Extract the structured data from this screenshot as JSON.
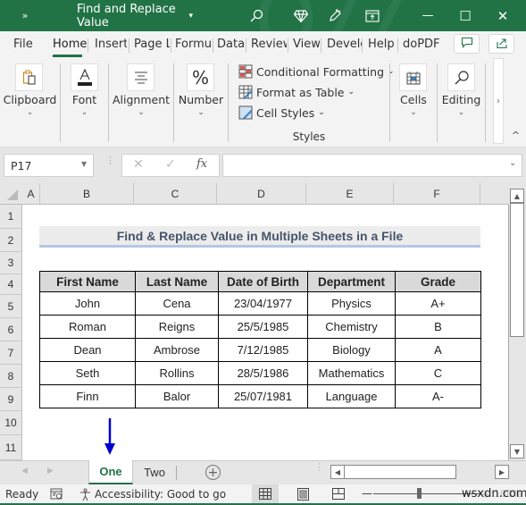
{
  "titlebar": {
    "overflow_label": "»",
    "doc_title": "Find and Replace Value",
    "title_caret": "⌄",
    "icons": [
      "search-icon",
      "diamond-icon",
      "pen-icon",
      "ribbon-display-icon"
    ],
    "minimize": "—",
    "maximize": "☐",
    "close": "✕"
  },
  "menu_tabs": {
    "items": [
      {
        "label": "File",
        "active": false
      },
      {
        "label": "Home",
        "active": true
      },
      {
        "label": "Insert",
        "active": false
      },
      {
        "label": "Page L",
        "active": false
      },
      {
        "label": "Formu",
        "active": false
      },
      {
        "label": "Data",
        "active": false
      },
      {
        "label": "Review",
        "active": false
      },
      {
        "label": "View",
        "active": false
      },
      {
        "label": "Develc",
        "active": false
      },
      {
        "label": "Help",
        "active": false
      },
      {
        "label": "doPDF",
        "active": false
      }
    ],
    "comments_icon": "comment-icon",
    "share_icon": "share-icon"
  },
  "ribbon": {
    "groups": [
      {
        "label": "Clipboard",
        "icon": "clipboard-icon",
        "caret": "⌄"
      },
      {
        "label": "Font",
        "icon": "font-color-icon",
        "caret": "⌄"
      },
      {
        "label": "Alignment",
        "icon": "align-icon",
        "caret": "⌄"
      },
      {
        "label": "Number",
        "icon": "percent-icon",
        "caret": "⌄"
      }
    ],
    "styles": {
      "items": [
        {
          "label": "Conditional Formatting",
          "caret": "⌄"
        },
        {
          "label": "Format as Table",
          "caret": "⌄"
        },
        {
          "label": "Cell Styles",
          "caret": "⌄"
        }
      ],
      "group_label": "Styles"
    },
    "cells": {
      "label": "Cells",
      "caret": "⌄"
    },
    "editing": {
      "label": "Editing",
      "caret": "⌄"
    },
    "scroll_right": "›",
    "collapse": "^"
  },
  "formula_bar": {
    "name_box": "P17",
    "cancel": "✕",
    "enter": "✓",
    "fx": "fx",
    "formula_value": "",
    "expand": "⌄"
  },
  "grid": {
    "columns": [
      "A",
      "B",
      "C",
      "D",
      "E",
      "F"
    ],
    "rows": [
      "1",
      "2",
      "3",
      "4",
      "5",
      "6",
      "7",
      "8",
      "9",
      "10",
      "11"
    ],
    "title": "Find & Replace Value in Multiple Sheets in a File",
    "table": {
      "headers": [
        "First Name",
        "Last Name",
        "Date of Birth",
        "Department",
        "Grade"
      ],
      "rows": [
        [
          "John",
          "Cena",
          "23/04/1977",
          "Physics",
          "A+"
        ],
        [
          "Roman",
          "Reigns",
          "25/5/1985",
          "Chemistry",
          "B"
        ],
        [
          "Dean",
          "Ambrose",
          "7/12/1985",
          "Biology",
          "A"
        ],
        [
          "Seth",
          "Rollins",
          "28/5/1986",
          "Mathematics",
          "C"
        ],
        [
          "Finn",
          "Balor",
          "25/07/1981",
          "Language",
          "A-"
        ]
      ]
    },
    "annotation_arrow_color": "#0000cc"
  },
  "sheet_tabs": {
    "prev": "◀",
    "next": "▶",
    "tabs": [
      {
        "label": "One",
        "active": true
      },
      {
        "label": "Two",
        "active": false
      }
    ],
    "add": "+"
  },
  "status_bar": {
    "ready": "Ready",
    "accessibility": "Accessibility: Good to go",
    "zoom_minus": "—",
    "zoom_plus": "+",
    "zoom_level": "100%",
    "watermark": "wsxdn.com"
  },
  "colors": {
    "brand": "#217346",
    "title_text": "#44546a",
    "header_fill": "#d9d9d9",
    "title_underline": "#b4c7e2"
  }
}
